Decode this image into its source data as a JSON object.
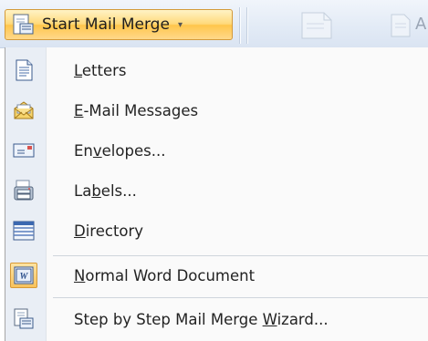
{
  "ribbon": {
    "start_mail_merge": {
      "label": "Start Mail Merge",
      "caret": "▾",
      "icon": "mail-merge-icon"
    },
    "partial_right": "A"
  },
  "menu": {
    "items": [
      {
        "key": "L",
        "rest": "etters",
        "icon": "document-icon"
      },
      {
        "key": "E",
        "rest": "-Mail Messages",
        "icon": "envelope-open-icon"
      },
      {
        "pre": "En",
        "key": "v",
        "rest": "elopes...",
        "icon": "envelope-icon"
      },
      {
        "pre": "La",
        "key": "b",
        "rest": "els...",
        "icon": "labels-icon"
      },
      {
        "key": "D",
        "rest": "irectory",
        "icon": "directory-icon"
      },
      {
        "key": "N",
        "rest": "ormal Word Document",
        "icon": "word-document-icon",
        "checked": true
      },
      {
        "pre": "Step by Step Mail Merge ",
        "key": "W",
        "rest": "izard...",
        "icon": "wizard-icon"
      }
    ]
  },
  "colors": {
    "highlight": "#ffd97a",
    "highlight_border": "#d49a3a",
    "gutter": "#e9eef5"
  }
}
